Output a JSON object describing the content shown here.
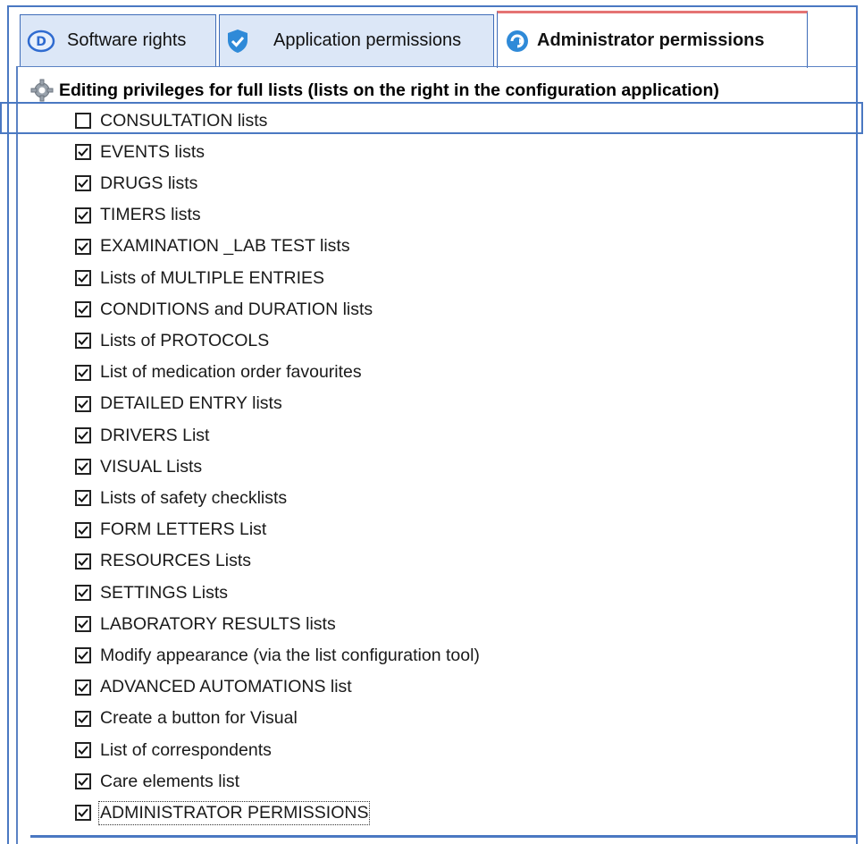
{
  "tabs": [
    {
      "label": "Software rights",
      "icon": "d-circle-icon",
      "active": false
    },
    {
      "label": "Application permissions",
      "icon": "shield-icon",
      "active": false
    },
    {
      "label": "Administrator permissions",
      "icon": "admin-refresh-icon",
      "active": true
    }
  ],
  "section": {
    "title": "Editing privileges for full lists (lists on the right in the configuration application)",
    "icon": "gear-icon"
  },
  "items": [
    {
      "label": "CONSULTATION lists",
      "checked": false
    },
    {
      "label": "EVENTS lists",
      "checked": true
    },
    {
      "label": "DRUGS lists",
      "checked": true
    },
    {
      "label": "TIMERS lists",
      "checked": true
    },
    {
      "label": "EXAMINATION _LAB TEST lists",
      "checked": true
    },
    {
      "label": "Lists of MULTIPLE ENTRIES",
      "checked": true
    },
    {
      "label": "CONDITIONS and DURATION lists",
      "checked": true
    },
    {
      "label": "Lists of PROTOCOLS",
      "checked": true
    },
    {
      "label": "List of medication order favourites",
      "checked": true
    },
    {
      "label": "DETAILED ENTRY lists",
      "checked": true
    },
    {
      "label": "DRIVERS List",
      "checked": true
    },
    {
      "label": "VISUAL Lists",
      "checked": true
    },
    {
      "label": "Lists of safety checklists",
      "checked": true
    },
    {
      "label": "FORM LETTERS List",
      "checked": true
    },
    {
      "label": "RESOURCES Lists",
      "checked": true
    },
    {
      "label": "SETTINGS Lists",
      "checked": true
    },
    {
      "label": "LABORATORY RESULTS lists",
      "checked": true
    },
    {
      "label": "Modify appearance (via the list configuration tool)",
      "checked": true
    },
    {
      "label": "ADVANCED AUTOMATIONS list",
      "checked": true
    },
    {
      "label": "Create a button for Visual",
      "checked": true
    },
    {
      "label": "List of correspondents",
      "checked": true
    },
    {
      "label": "Care elements list",
      "checked": true
    },
    {
      "label": "ADMINISTRATOR PERMISSIONS",
      "checked": true,
      "focused": true
    }
  ],
  "colors": {
    "accent": "#4a78c2",
    "tab_inactive": "#dce7f7",
    "active_tab_top": "#e57373"
  }
}
